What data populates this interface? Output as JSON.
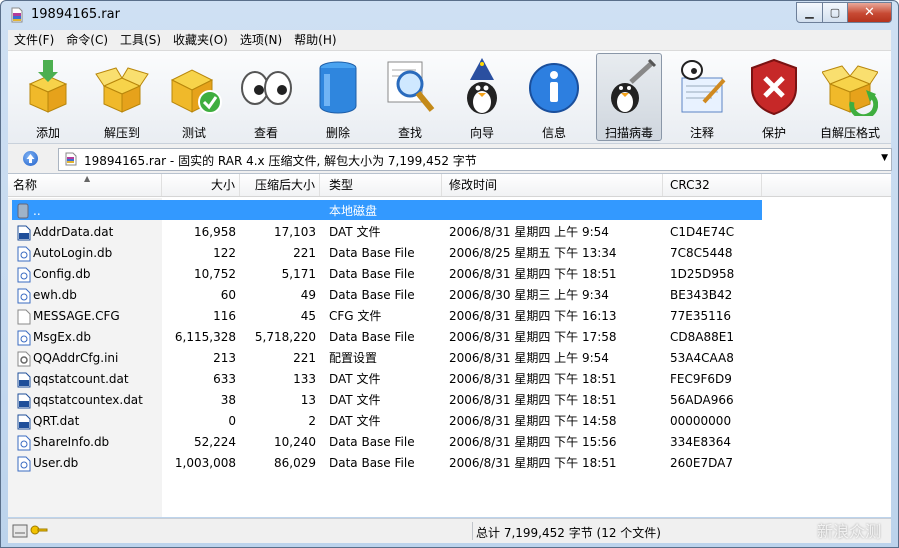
{
  "window": {
    "title": "19894165.rar"
  },
  "menu": [
    "文件(F)",
    "命令(C)",
    "工具(S)",
    "收藏夹(O)",
    "选项(N)",
    "帮助(H)"
  ],
  "toolbar": [
    {
      "label": "添加",
      "icon": "add-archive-icon"
    },
    {
      "label": "解压到",
      "icon": "extract-to-icon"
    },
    {
      "label": "测试",
      "icon": "test-archive-icon"
    },
    {
      "label": "查看",
      "icon": "view-icon"
    },
    {
      "label": "删除",
      "icon": "delete-icon"
    },
    {
      "label": "查找",
      "icon": "find-icon"
    },
    {
      "label": "向导",
      "icon": "wizard-icon"
    },
    {
      "label": "信息",
      "icon": "info-icon"
    },
    {
      "label": "扫描病毒",
      "icon": "virus-scan-icon"
    },
    {
      "label": "注释",
      "icon": "comment-icon"
    },
    {
      "label": "保护",
      "icon": "protect-icon"
    },
    {
      "label": "自解压格式",
      "icon": "sfx-icon"
    }
  ],
  "address": {
    "text": "19894165.rar - 固实的 RAR 4.x 压缩文件, 解包大小为 7,199,452 字节"
  },
  "columns": [
    "名称",
    "大小",
    "压缩后大小",
    "类型",
    "修改时间",
    "CRC32"
  ],
  "parent_row": {
    "name": "..",
    "type": "本地磁盘"
  },
  "files": [
    {
      "name": "AddrData.dat",
      "size": "16,958",
      "packed": "17,103",
      "type": "DAT 文件",
      "modified": "2006/8/31 星期四 上午 9:54",
      "crc": "C1D4E74C",
      "icon": "dat"
    },
    {
      "name": "AutoLogin.db",
      "size": "122",
      "packed": "221",
      "type": "Data Base File",
      "modified": "2006/8/25 星期五 下午 13:34",
      "crc": "7C8C5448",
      "icon": "db"
    },
    {
      "name": "Config.db",
      "size": "10,752",
      "packed": "5,171",
      "type": "Data Base File",
      "modified": "2006/8/31 星期四 下午 18:51",
      "crc": "1D25D958",
      "icon": "db"
    },
    {
      "name": "ewh.db",
      "size": "60",
      "packed": "49",
      "type": "Data Base File",
      "modified": "2006/8/30 星期三 上午 9:34",
      "crc": "BE343B42",
      "icon": "db"
    },
    {
      "name": "MESSAGE.CFG",
      "size": "116",
      "packed": "45",
      "type": "CFG 文件",
      "modified": "2006/8/31 星期四 下午 16:13",
      "crc": "77E35116",
      "icon": "blank"
    },
    {
      "name": "MsgEx.db",
      "size": "6,115,328",
      "packed": "5,718,220",
      "type": "Data Base File",
      "modified": "2006/8/31 星期四 下午 17:58",
      "crc": "CD8A88E1",
      "icon": "db"
    },
    {
      "name": "QQAddrCfg.ini",
      "size": "213",
      "packed": "221",
      "type": "配置设置",
      "modified": "2006/8/31 星期四 上午 9:54",
      "crc": "53A4CAA8",
      "icon": "ini"
    },
    {
      "name": "qqstatcount.dat",
      "size": "633",
      "packed": "133",
      "type": "DAT 文件",
      "modified": "2006/8/31 星期四 下午 18:51",
      "crc": "FEC9F6D9",
      "icon": "dat"
    },
    {
      "name": "qqstatcountex.dat",
      "size": "38",
      "packed": "13",
      "type": "DAT 文件",
      "modified": "2006/8/31 星期四 下午 18:51",
      "crc": "56ADA966",
      "icon": "dat"
    },
    {
      "name": "QRT.dat",
      "size": "0",
      "packed": "2",
      "type": "DAT 文件",
      "modified": "2006/8/31 星期四 下午 14:58",
      "crc": "00000000",
      "icon": "dat"
    },
    {
      "name": "ShareInfo.db",
      "size": "52,224",
      "packed": "10,240",
      "type": "Data Base File",
      "modified": "2006/8/31 星期四 下午 15:56",
      "crc": "334E8364",
      "icon": "db"
    },
    {
      "name": "User.db",
      "size": "1,003,008",
      "packed": "86,029",
      "type": "Data Base File",
      "modified": "2006/8/31 星期四 下午 18:51",
      "crc": "260E7DA7",
      "icon": "db"
    }
  ],
  "status": {
    "text": "总计 7,199,452 字节 (12 个文件)"
  },
  "watermark": "新浪众测"
}
